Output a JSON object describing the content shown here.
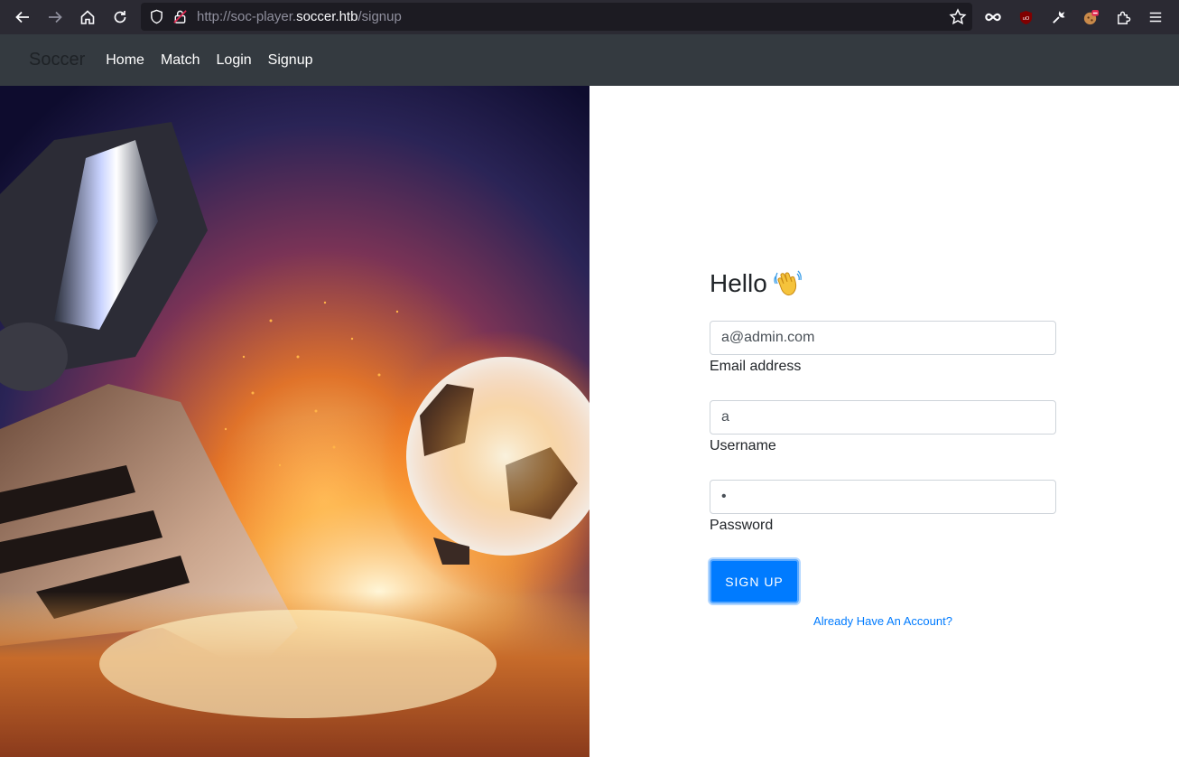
{
  "browser": {
    "url_prefix": "http://soc-player.",
    "url_host": "soccer.htb",
    "url_path": "/signup"
  },
  "navbar": {
    "brand": "Soccer",
    "links": [
      "Home",
      "Match",
      "Login",
      "Signup"
    ]
  },
  "form": {
    "greeting": "Hello",
    "email_value": "a@admin.com",
    "email_label": "Email address",
    "username_value": "a",
    "username_label": "Username",
    "password_value": "•",
    "password_label": "Password",
    "submit_label": "SIGN UP",
    "account_link": "Already Have An Account?"
  },
  "colors": {
    "navbar_bg": "#343a40",
    "primary": "#007bff",
    "browser_bg": "#2b2a33"
  }
}
